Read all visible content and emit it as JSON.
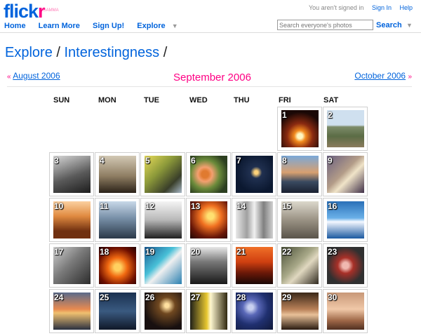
{
  "header": {
    "logo_left": "flick",
    "logo_right": "r",
    "logo_tag": "GAMMA",
    "signed_in_text": "You aren't signed in",
    "sign_in": "Sign In",
    "help": "Help"
  },
  "nav": {
    "items": [
      "Home",
      "Learn More",
      "Sign Up!",
      "Explore"
    ],
    "caret": "▼"
  },
  "search": {
    "placeholder": "Search everyone's photos",
    "button": "Search",
    "caret": "▼"
  },
  "breadcrumb": {
    "part1": "Explore",
    "sep1": "/",
    "part2": "Interestingness",
    "sep2": "/"
  },
  "month_nav": {
    "prev_arrows": "«",
    "prev": "August 2006",
    "current": "September 2006",
    "next": "October 2006",
    "next_arrows": "»"
  },
  "weekdays": [
    "SUN",
    "MON",
    "TUE",
    "WED",
    "THU",
    "FRI",
    "SAT"
  ],
  "days": [
    {
      "n": "1",
      "icon": "candle-photo"
    },
    {
      "n": "2",
      "icon": "landscape-photo"
    },
    {
      "n": "3",
      "icon": "bridge-photo"
    },
    {
      "n": "4",
      "icon": "silhouette-photo"
    },
    {
      "n": "5",
      "icon": "highway-photo"
    },
    {
      "n": "6",
      "icon": "flowers-photo"
    },
    {
      "n": "7",
      "icon": "moon-photo"
    },
    {
      "n": "8",
      "icon": "harbor-photo"
    },
    {
      "n": "9",
      "icon": "hands-photo"
    },
    {
      "n": "10",
      "icon": "sunset-field-photo"
    },
    {
      "n": "11",
      "icon": "interior-photo"
    },
    {
      "n": "12",
      "icon": "dancer-photo"
    },
    {
      "n": "13",
      "icon": "fire-dancer-photo"
    },
    {
      "n": "14",
      "icon": "forest-photo"
    },
    {
      "n": "15",
      "icon": "dog-photo"
    },
    {
      "n": "16",
      "icon": "surf-photo"
    },
    {
      "n": "17",
      "icon": "shell-photo"
    },
    {
      "n": "18",
      "icon": "flames-photo"
    },
    {
      "n": "19",
      "icon": "pool-photo"
    },
    {
      "n": "20",
      "icon": "portrait-bw-photo"
    },
    {
      "n": "21",
      "icon": "sunset-sea-photo"
    },
    {
      "n": "22",
      "icon": "woman-portrait-photo"
    },
    {
      "n": "23",
      "icon": "lantern-photo"
    },
    {
      "n": "24",
      "icon": "beach-sunset-photo"
    },
    {
      "n": "25",
      "icon": "rain-photo"
    },
    {
      "n": "26",
      "icon": "concert-photo"
    },
    {
      "n": "27",
      "icon": "subway-photo"
    },
    {
      "n": "28",
      "icon": "spiral-photo"
    },
    {
      "n": "29",
      "icon": "face-photo"
    },
    {
      "n": "30",
      "icon": "girl-portrait-photo"
    }
  ]
}
